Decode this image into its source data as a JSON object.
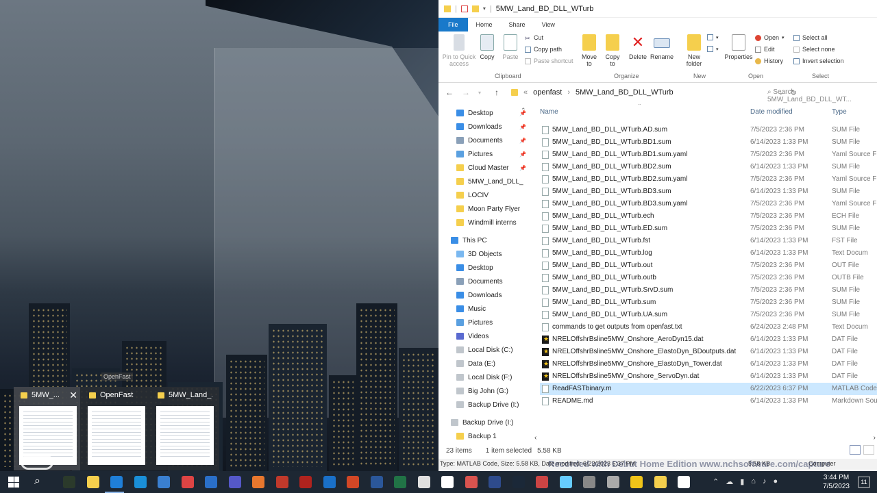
{
  "thumbnails": [
    {
      "title": "5MW_..."
    },
    {
      "title": "OpenFast"
    },
    {
      "title": "5MW_Land_..."
    }
  ],
  "thumb_tooltip": "OpenFast",
  "explorer": {
    "title": "5MW_Land_BD_DLL_WTurb",
    "tabs": [
      "File",
      "Home",
      "Share",
      "View"
    ],
    "ribbon": {
      "clipboard": {
        "label": "Clipboard",
        "pin": "Pin to Quick access",
        "copy": "Copy",
        "paste": "Paste",
        "cut": "Cut",
        "copy_path": "Copy path",
        "paste_shortcut": "Paste shortcut"
      },
      "organize": {
        "label": "Organize",
        "move_to": "Move to",
        "copy_to": "Copy to",
        "delete": "Delete",
        "rename": "Rename"
      },
      "new": {
        "label": "New",
        "new_folder": "New folder"
      },
      "open": {
        "label": "Open",
        "properties": "Properties",
        "open": "Open",
        "edit": "Edit",
        "history": "History"
      },
      "select": {
        "label": "Select",
        "select_all": "Select all",
        "select_none": "Select none",
        "invert": "Invert selection"
      }
    },
    "address": {
      "root": "«",
      "crumbs": [
        "openfast",
        "5MW_Land_BD_DLL_WTurb"
      ],
      "search_placeholder": "Search 5MW_Land_BD_DLL_WT..."
    },
    "nav": {
      "quick": [
        "Desktop",
        "Downloads",
        "Documents",
        "Pictures",
        "Cloud Master",
        "5MW_Land_DLL_",
        "LOCIV",
        "Moon Party Flyer",
        "Windmill interns"
      ],
      "this_pc": "This PC",
      "pc_items": [
        "3D Objects",
        "Desktop",
        "Documents",
        "Downloads",
        "Music",
        "Pictures",
        "Videos",
        "Local Disk (C:)",
        "Data (E:)",
        "Local Disk (F:)",
        "Big John (G:)",
        "Backup Drive (I:)"
      ],
      "backup_drive": "Backup Drive (I:)",
      "backup_1": "Backup 1"
    },
    "columns": {
      "name": "Name",
      "date": "Date modified",
      "type": "Type"
    },
    "files": [
      {
        "name": "5MW_Land_BD_DLL_WTurb.AD.sum",
        "date": "7/5/2023 2:36 PM",
        "type": "SUM File",
        "icon": "doc"
      },
      {
        "name": "5MW_Land_BD_DLL_WTurb.BD1.sum",
        "date": "6/14/2023 1:33 PM",
        "type": "SUM File",
        "icon": "doc"
      },
      {
        "name": "5MW_Land_BD_DLL_WTurb.BD1.sum.yaml",
        "date": "7/5/2023 2:36 PM",
        "type": "Yaml Source Fi",
        "icon": "doc"
      },
      {
        "name": "5MW_Land_BD_DLL_WTurb.BD2.sum",
        "date": "6/14/2023 1:33 PM",
        "type": "SUM File",
        "icon": "doc"
      },
      {
        "name": "5MW_Land_BD_DLL_WTurb.BD2.sum.yaml",
        "date": "7/5/2023 2:36 PM",
        "type": "Yaml Source Fi",
        "icon": "doc"
      },
      {
        "name": "5MW_Land_BD_DLL_WTurb.BD3.sum",
        "date": "6/14/2023 1:33 PM",
        "type": "SUM File",
        "icon": "doc"
      },
      {
        "name": "5MW_Land_BD_DLL_WTurb.BD3.sum.yaml",
        "date": "7/5/2023 2:36 PM",
        "type": "Yaml Source Fi",
        "icon": "doc"
      },
      {
        "name": "5MW_Land_BD_DLL_WTurb.ech",
        "date": "7/5/2023 2:36 PM",
        "type": "ECH File",
        "icon": "doc"
      },
      {
        "name": "5MW_Land_BD_DLL_WTurb.ED.sum",
        "date": "7/5/2023 2:36 PM",
        "type": "SUM File",
        "icon": "doc"
      },
      {
        "name": "5MW_Land_BD_DLL_WTurb.fst",
        "date": "6/14/2023 1:33 PM",
        "type": "FST File",
        "icon": "doc"
      },
      {
        "name": "5MW_Land_BD_DLL_WTurb.log",
        "date": "6/14/2023 1:33 PM",
        "type": "Text Docum",
        "icon": "doc"
      },
      {
        "name": "5MW_Land_BD_DLL_WTurb.out",
        "date": "7/5/2023 2:36 PM",
        "type": "OUT File",
        "icon": "doc"
      },
      {
        "name": "5MW_Land_BD_DLL_WTurb.outb",
        "date": "7/5/2023 2:36 PM",
        "type": "OUTB File",
        "icon": "doc"
      },
      {
        "name": "5MW_Land_BD_DLL_WTurb.SrvD.sum",
        "date": "7/5/2023 2:36 PM",
        "type": "SUM File",
        "icon": "doc"
      },
      {
        "name": "5MW_Land_BD_DLL_WTurb.sum",
        "date": "7/5/2023 2:36 PM",
        "type": "SUM File",
        "icon": "doc"
      },
      {
        "name": "5MW_Land_BD_DLL_WTurb.UA.sum",
        "date": "7/5/2023 2:36 PM",
        "type": "SUM File",
        "icon": "doc"
      },
      {
        "name": "commands to get outputs from openfast.txt",
        "date": "6/24/2023 2:48 PM",
        "type": "Text Docum",
        "icon": "doc"
      },
      {
        "name": "NRELOffshrBsline5MW_Onshore_AeroDyn15.dat",
        "date": "6/14/2023 1:33 PM",
        "type": "DAT File",
        "icon": "dat"
      },
      {
        "name": "NRELOffshrBsline5MW_Onshore_ElastoDyn_BDoutputs.dat",
        "date": "6/14/2023 1:33 PM",
        "type": "DAT File",
        "icon": "dat"
      },
      {
        "name": "NRELOffshrBsline5MW_Onshore_ElastoDyn_Tower.dat",
        "date": "6/14/2023 1:33 PM",
        "type": "DAT File",
        "icon": "dat"
      },
      {
        "name": "NRELOffshrBsline5MW_Onshore_ServoDyn.dat",
        "date": "6/14/2023 1:33 PM",
        "type": "DAT File",
        "icon": "dat"
      },
      {
        "name": "ReadFASTbinary.m",
        "date": "6/22/2023 6:37 PM",
        "type": "MATLAB Code",
        "icon": "doc",
        "selected": true
      },
      {
        "name": "README.md",
        "date": "6/14/2023 1:33 PM",
        "type": "Markdown Sou",
        "icon": "doc"
      }
    ],
    "status": {
      "items": "23 items",
      "selected": "1 item selected",
      "size": "5.58 KB"
    },
    "details": {
      "left": "Type: MATLAB Code, Size: 5.58 KB, Date modified: 6/22/2023 6:37 PM",
      "size": "5.58 KB",
      "location": "Computer"
    }
  },
  "watermark": "Recorded with Debut Home Edition  www.nchsoftware.com/capture",
  "taskbar": {
    "time": "3:44 PM",
    "date": "7/5/2023",
    "notif_count": "11"
  },
  "colors": {
    "accent": "#1979ca",
    "selection": "#cce8ff",
    "folder": "#f5cf4d",
    "taskbar": "#1d2733"
  }
}
